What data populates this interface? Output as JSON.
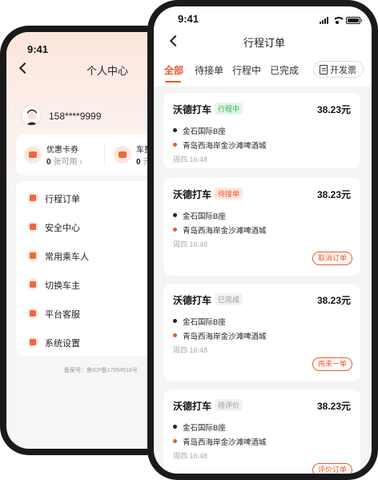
{
  "back_screen": {
    "status_time": "9:41",
    "title": "个人中心",
    "phone": "158****9999",
    "wallet": [
      {
        "label": "优惠卡券",
        "count": "0",
        "unit": "张可用",
        "arrow": "›"
      },
      {
        "label": "车费",
        "count": "0",
        "unit": "元"
      }
    ],
    "menu": [
      {
        "label": "行程订单",
        "icon": "order-icon"
      },
      {
        "label": "安全中心",
        "icon": "shield-icon"
      },
      {
        "label": "常用乘车人",
        "icon": "person-icon"
      },
      {
        "label": "切换车主",
        "icon": "car-icon"
      },
      {
        "label": "平台客服",
        "icon": "phone-icon"
      },
      {
        "label": "系统设置",
        "icon": "gear-icon"
      }
    ],
    "icp": "备案号：鲁ICP备17054518号"
  },
  "front_screen": {
    "status_time": "9:41",
    "title": "行程订单",
    "tabs": [
      "全部",
      "待接单",
      "行程中",
      "已完成"
    ],
    "invoice_label": "开发票",
    "orders": [
      {
        "title": "沃德打车",
        "status": "行程中",
        "price": "38.23元",
        "from": "金石国际B座",
        "to": "青岛西海岸金沙滩啤酒城",
        "time": "周四 16:48",
        "action": ""
      },
      {
        "title": "沃德打车",
        "status": "待接单",
        "price": "38.23元",
        "from": "金石国际B座",
        "to": "青岛西海岸金沙滩啤酒城",
        "time": "周四 16:48",
        "action": "取消订单"
      },
      {
        "title": "沃德打车",
        "status": "已完成",
        "price": "38.23元",
        "from": "金石国际B座",
        "to": "青岛西海岸金沙滩啤酒城",
        "time": "周四 16:48",
        "action": "再来一单"
      },
      {
        "title": "沃德打车",
        "status": "待评价",
        "price": "38.23元",
        "from": "金石国际B座",
        "to": "青岛西海岸金沙滩啤酒城",
        "time": "周四 16:48",
        "action": "评价订单"
      }
    ]
  },
  "colors": {
    "accent": "#f0572b",
    "green": "#2bb24c"
  }
}
